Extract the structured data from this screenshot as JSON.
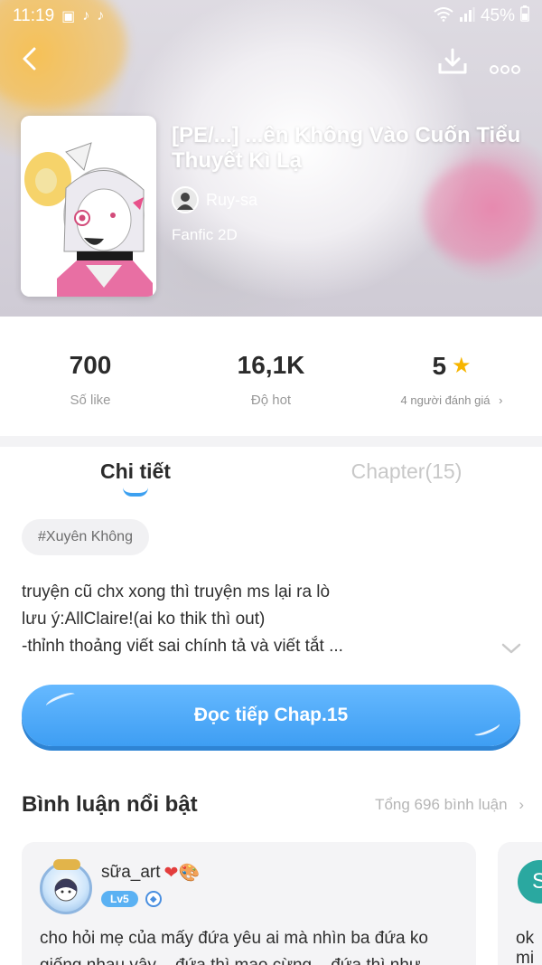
{
  "status_bar": {
    "time": "11:19",
    "battery": "45%",
    "icons": [
      "gallery-icon",
      "tiktok-icon",
      "tiktok-icon",
      "wifi-icon",
      "signal-icon",
      "battery-icon"
    ]
  },
  "header": {
    "back_icon": "back-arrow-icon",
    "download_icon": "download-icon",
    "more_icon": "more-icon"
  },
  "story": {
    "title": "[PE/...] ...ên Không Vào Cuốn Tiểu Thuyết Kì Lạ",
    "author": "Ruy-sa",
    "genre": "Fanfic 2D"
  },
  "stats": {
    "likes": {
      "value": "700",
      "label": "Số like"
    },
    "hot": {
      "value": "16,1K",
      "label": "Độ hot"
    },
    "rating": {
      "value": "5",
      "label": "4 người đánh giá",
      "chevron": "›"
    }
  },
  "tabs": {
    "details": "Chi tiết",
    "chapters": "Chapter(15)"
  },
  "tag": "#Xuyên Không",
  "description": [
    "truyện cũ chx xong thì truyện ms lại ra lò",
    "lưu ý:AllClaire!(ai ko thik thì out)",
    "-thỉnh thoảng viết sai chính tả và viết tắt ..."
  ],
  "expand_icon": "chevron-down-icon",
  "read_button": "Đọc tiếp Chap.15",
  "comments_section": {
    "title": "Bình luận nổi bật",
    "total": "Tổng 696 bình luận",
    "chevron": "›"
  },
  "comments": [
    {
      "user": "sữa_art",
      "emoji": "❤🎨",
      "level": "Lv5",
      "text": "cho hỏi mẹ của mấy đứa yêu ai mà nhìn ba đứa ko",
      "text2": "giống nhau vậy ...đứa thì mạo cừng ...đứa thì như"
    },
    {
      "avatar_letter": "S",
      "text": "ok",
      "text2": "mi"
    }
  ],
  "colors": {
    "accent_blue": "#3e9ef3",
    "star_yellow": "#f7b500",
    "text_dark": "#2b2b2b",
    "text_muted": "#9a9a9a"
  }
}
